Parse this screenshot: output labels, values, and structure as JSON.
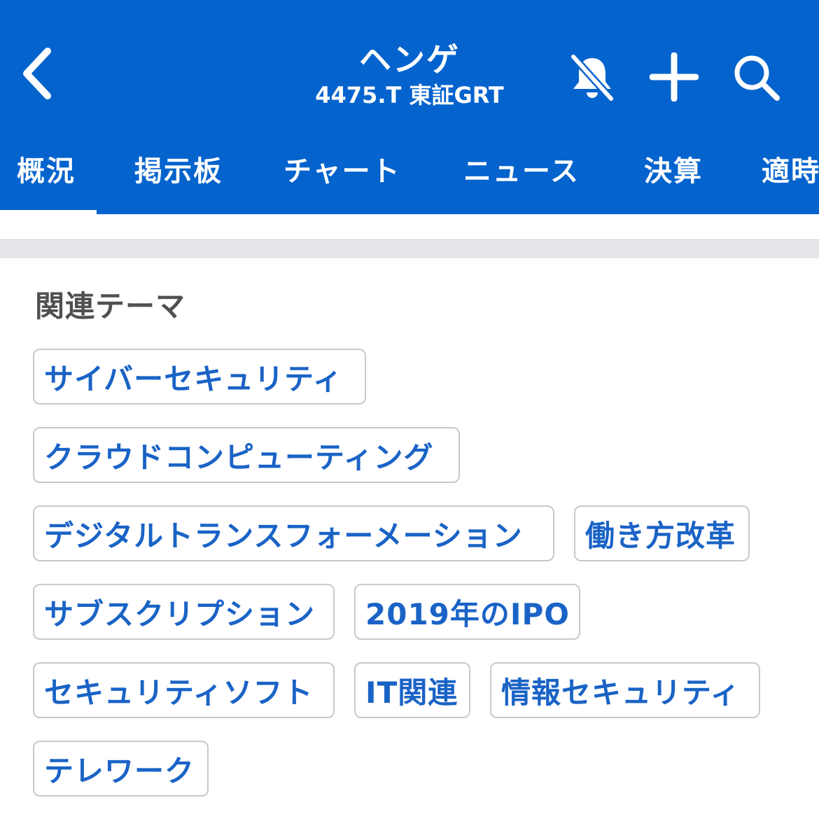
{
  "header": {
    "title": "ヘンゲ",
    "subtitle": "4475.T 東証GRT",
    "icons": {
      "back": "chevron-left-icon",
      "bell": "bell-slash-icon",
      "add": "plus-icon",
      "search": "search-icon"
    }
  },
  "tabs": [
    {
      "label": "概況",
      "active": true
    },
    {
      "label": "掲示板"
    },
    {
      "label": "チャート"
    },
    {
      "label": "ニュース"
    },
    {
      "label": "決算"
    },
    {
      "label": "適時"
    }
  ],
  "related": {
    "title": "関連テーマ",
    "tags": [
      "サイバーセキュリティ",
      "クラウドコンピューティング",
      "デジタルトランスフォーメーション",
      "働き方改革",
      "サブスクリプション",
      "2019年のIPO",
      "セキュリティソフト",
      "IT関連",
      "情報セキュリティ",
      "テレワーク"
    ]
  },
  "colors": {
    "brand": "#0463cd",
    "tag_text": "#1a63c6",
    "tag_border": "#c7c8d0",
    "section_title": "#505050"
  }
}
